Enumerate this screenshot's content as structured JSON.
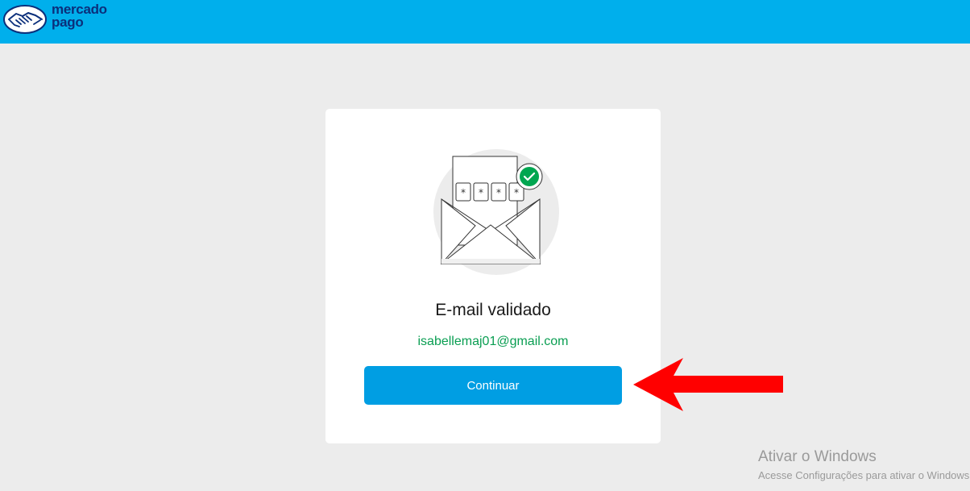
{
  "header": {
    "logo_line1": "mercado",
    "logo_line2": "pago",
    "bg_color": "#00afec",
    "logo_icon": "handshake-icon"
  },
  "card": {
    "illustration_icon": "envelope-verified-icon",
    "title": "E-mail validado",
    "email": "isabellemaj01@gmail.com",
    "button_label": "Continuar",
    "pin_mask": [
      "*",
      "*",
      "*",
      "*"
    ]
  },
  "annotation": {
    "arrow_color": "#ff0000",
    "arrow_icon": "red-arrow-pointing-left"
  },
  "watermark": {
    "title": "Ativar o Windows",
    "subtitle": "Acesse Configurações para ativar o Windows."
  },
  "colors": {
    "page_bg": "#ececec",
    "button": "#009ee3",
    "email_text": "#0a9e52",
    "check_green": "#00a650"
  }
}
